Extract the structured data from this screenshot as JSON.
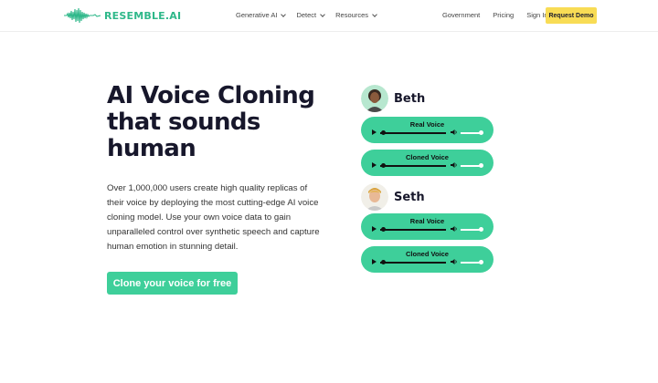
{
  "brand": {
    "name": "RESEMBLE.AI",
    "color": "#2fb88a"
  },
  "nav": {
    "menus": [
      {
        "label": "Generative AI"
      },
      {
        "label": "Detect"
      },
      {
        "label": "Resources"
      }
    ],
    "links": [
      {
        "label": "Government"
      },
      {
        "label": "Pricing"
      },
      {
        "label": "Sign In"
      }
    ],
    "cta": {
      "label": "Request Demo",
      "color": "#f8dc55"
    }
  },
  "hero": {
    "title_lines": [
      "AI Voice Cloning",
      "that sounds",
      "human"
    ],
    "description": "Over 1,000,000 users create high quality replicas of their voice by deploying the most cutting-edge AI voice cloning model. Use your own voice data to gain unparalleled control over synthetic speech  and capture human emotion in stunning detail.",
    "cta": {
      "label": "Clone your voice for free",
      "color": "#3ecf9a"
    }
  },
  "demos": [
    {
      "name": "Beth",
      "players": [
        {
          "label": "Real Voice"
        },
        {
          "label": "Cloned Voice"
        }
      ]
    },
    {
      "name": "Seth",
      "players": [
        {
          "label": "Real Voice"
        },
        {
          "label": "Cloned Voice"
        }
      ]
    }
  ],
  "icons": {
    "logo": "waveform-icon",
    "play": "play-icon",
    "volume": "volume-icon",
    "dropdown": "chevron-down-icon"
  }
}
